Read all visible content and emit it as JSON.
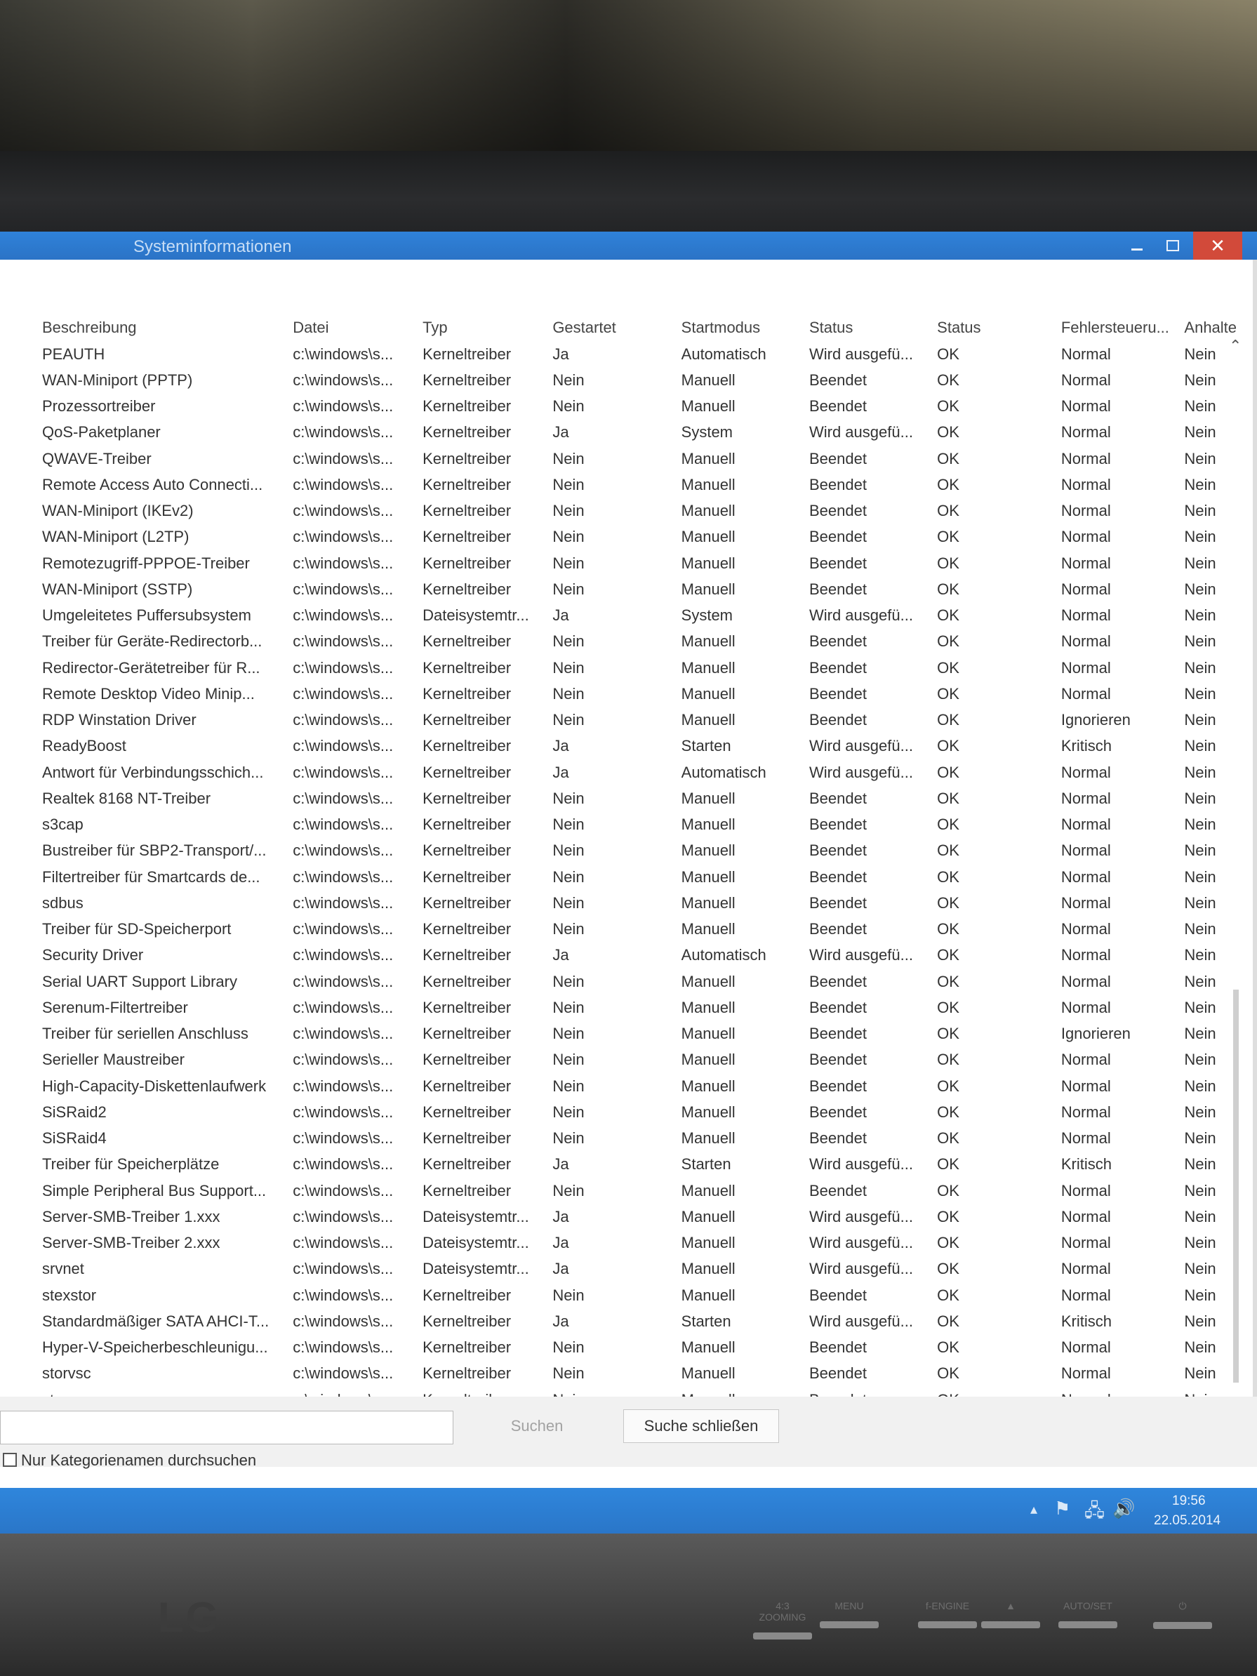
{
  "window": {
    "title": "Systeminformationen",
    "close_glyph": "✕"
  },
  "columns": [
    "Beschreibung",
    "Datei",
    "Typ",
    "Gestartet",
    "Startmodus",
    "Status",
    "Status",
    "Fehlersteueru...",
    "Anhalte"
  ],
  "rows": [
    [
      "PEAUTH",
      "c:\\windows\\s...",
      "Kerneltreiber",
      "Ja",
      "Automatisch",
      "Wird ausgefü...",
      "OK",
      "Normal",
      "Nein"
    ],
    [
      "WAN-Miniport (PPTP)",
      "c:\\windows\\s...",
      "Kerneltreiber",
      "Nein",
      "Manuell",
      "Beendet",
      "OK",
      "Normal",
      "Nein"
    ],
    [
      "Prozessortreiber",
      "c:\\windows\\s...",
      "Kerneltreiber",
      "Nein",
      "Manuell",
      "Beendet",
      "OK",
      "Normal",
      "Nein"
    ],
    [
      "QoS-Paketplaner",
      "c:\\windows\\s...",
      "Kerneltreiber",
      "Ja",
      "System",
      "Wird ausgefü...",
      "OK",
      "Normal",
      "Nein"
    ],
    [
      "QWAVE-Treiber",
      "c:\\windows\\s...",
      "Kerneltreiber",
      "Nein",
      "Manuell",
      "Beendet",
      "OK",
      "Normal",
      "Nein"
    ],
    [
      "Remote Access Auto Connecti...",
      "c:\\windows\\s...",
      "Kerneltreiber",
      "Nein",
      "Manuell",
      "Beendet",
      "OK",
      "Normal",
      "Nein"
    ],
    [
      "WAN-Miniport (IKEv2)",
      "c:\\windows\\s...",
      "Kerneltreiber",
      "Nein",
      "Manuell",
      "Beendet",
      "OK",
      "Normal",
      "Nein"
    ],
    [
      "WAN-Miniport (L2TP)",
      "c:\\windows\\s...",
      "Kerneltreiber",
      "Nein",
      "Manuell",
      "Beendet",
      "OK",
      "Normal",
      "Nein"
    ],
    [
      "Remotezugriff-PPPOE-Treiber",
      "c:\\windows\\s...",
      "Kerneltreiber",
      "Nein",
      "Manuell",
      "Beendet",
      "OK",
      "Normal",
      "Nein"
    ],
    [
      "WAN-Miniport (SSTP)",
      "c:\\windows\\s...",
      "Kerneltreiber",
      "Nein",
      "Manuell",
      "Beendet",
      "OK",
      "Normal",
      "Nein"
    ],
    [
      "Umgeleitetes Puffersubsystem",
      "c:\\windows\\s...",
      "Dateisystemtr...",
      "Ja",
      "System",
      "Wird ausgefü...",
      "OK",
      "Normal",
      "Nein"
    ],
    [
      "Treiber für Geräte-Redirectorb...",
      "c:\\windows\\s...",
      "Kerneltreiber",
      "Nein",
      "Manuell",
      "Beendet",
      "OK",
      "Normal",
      "Nein"
    ],
    [
      "Redirector-Gerätetreiber für R...",
      "c:\\windows\\s...",
      "Kerneltreiber",
      "Nein",
      "Manuell",
      "Beendet",
      "OK",
      "Normal",
      "Nein"
    ],
    [
      "Remote Desktop Video Minip...",
      "c:\\windows\\s...",
      "Kerneltreiber",
      "Nein",
      "Manuell",
      "Beendet",
      "OK",
      "Normal",
      "Nein"
    ],
    [
      "RDP Winstation Driver",
      "c:\\windows\\s...",
      "Kerneltreiber",
      "Nein",
      "Manuell",
      "Beendet",
      "OK",
      "Ignorieren",
      "Nein"
    ],
    [
      "ReadyBoost",
      "c:\\windows\\s...",
      "Kerneltreiber",
      "Ja",
      "Starten",
      "Wird ausgefü...",
      "OK",
      "Kritisch",
      "Nein"
    ],
    [
      "Antwort für Verbindungsschich...",
      "c:\\windows\\s...",
      "Kerneltreiber",
      "Ja",
      "Automatisch",
      "Wird ausgefü...",
      "OK",
      "Normal",
      "Nein"
    ],
    [
      "Realtek 8168 NT-Treiber",
      "c:\\windows\\s...",
      "Kerneltreiber",
      "Nein",
      "Manuell",
      "Beendet",
      "OK",
      "Normal",
      "Nein"
    ],
    [
      "s3cap",
      "c:\\windows\\s...",
      "Kerneltreiber",
      "Nein",
      "Manuell",
      "Beendet",
      "OK",
      "Normal",
      "Nein"
    ],
    [
      "Bustreiber für SBP2-Transport/...",
      "c:\\windows\\s...",
      "Kerneltreiber",
      "Nein",
      "Manuell",
      "Beendet",
      "OK",
      "Normal",
      "Nein"
    ],
    [
      "Filtertreiber für Smartcards de...",
      "c:\\windows\\s...",
      "Kerneltreiber",
      "Nein",
      "Manuell",
      "Beendet",
      "OK",
      "Normal",
      "Nein"
    ],
    [
      "sdbus",
      "c:\\windows\\s...",
      "Kerneltreiber",
      "Nein",
      "Manuell",
      "Beendet",
      "OK",
      "Normal",
      "Nein"
    ],
    [
      "Treiber für SD-Speicherport",
      "c:\\windows\\s...",
      "Kerneltreiber",
      "Nein",
      "Manuell",
      "Beendet",
      "OK",
      "Normal",
      "Nein"
    ],
    [
      "Security Driver",
      "c:\\windows\\s...",
      "Kerneltreiber",
      "Ja",
      "Automatisch",
      "Wird ausgefü...",
      "OK",
      "Normal",
      "Nein"
    ],
    [
      "Serial UART Support Library",
      "c:\\windows\\s...",
      "Kerneltreiber",
      "Nein",
      "Manuell",
      "Beendet",
      "OK",
      "Normal",
      "Nein"
    ],
    [
      "Serenum-Filtertreiber",
      "c:\\windows\\s...",
      "Kerneltreiber",
      "Nein",
      "Manuell",
      "Beendet",
      "OK",
      "Normal",
      "Nein"
    ],
    [
      "Treiber für seriellen Anschluss",
      "c:\\windows\\s...",
      "Kerneltreiber",
      "Nein",
      "Manuell",
      "Beendet",
      "OK",
      "Ignorieren",
      "Nein"
    ],
    [
      "Serieller Maustreiber",
      "c:\\windows\\s...",
      "Kerneltreiber",
      "Nein",
      "Manuell",
      "Beendet",
      "OK",
      "Normal",
      "Nein"
    ],
    [
      "High-Capacity-Diskettenlaufwerk",
      "c:\\windows\\s...",
      "Kerneltreiber",
      "Nein",
      "Manuell",
      "Beendet",
      "OK",
      "Normal",
      "Nein"
    ],
    [
      "SiSRaid2",
      "c:\\windows\\s...",
      "Kerneltreiber",
      "Nein",
      "Manuell",
      "Beendet",
      "OK",
      "Normal",
      "Nein"
    ],
    [
      "SiSRaid4",
      "c:\\windows\\s...",
      "Kerneltreiber",
      "Nein",
      "Manuell",
      "Beendet",
      "OK",
      "Normal",
      "Nein"
    ],
    [
      "Treiber für Speicherplätze",
      "c:\\windows\\s...",
      "Kerneltreiber",
      "Ja",
      "Starten",
      "Wird ausgefü...",
      "OK",
      "Kritisch",
      "Nein"
    ],
    [
      "Simple Peripheral Bus Support...",
      "c:\\windows\\s...",
      "Kerneltreiber",
      "Nein",
      "Manuell",
      "Beendet",
      "OK",
      "Normal",
      "Nein"
    ],
    [
      "Server-SMB-Treiber 1.xxx",
      "c:\\windows\\s...",
      "Dateisystemtr...",
      "Ja",
      "Manuell",
      "Wird ausgefü...",
      "OK",
      "Normal",
      "Nein"
    ],
    [
      "Server-SMB-Treiber 2.xxx",
      "c:\\windows\\s...",
      "Dateisystemtr...",
      "Ja",
      "Manuell",
      "Wird ausgefü...",
      "OK",
      "Normal",
      "Nein"
    ],
    [
      "srvnet",
      "c:\\windows\\s...",
      "Dateisystemtr...",
      "Ja",
      "Manuell",
      "Wird ausgefü...",
      "OK",
      "Normal",
      "Nein"
    ],
    [
      "stexstor",
      "c:\\windows\\s...",
      "Kerneltreiber",
      "Nein",
      "Manuell",
      "Beendet",
      "OK",
      "Normal",
      "Nein"
    ],
    [
      "Standardmäßiger SATA AHCI-T...",
      "c:\\windows\\s...",
      "Kerneltreiber",
      "Ja",
      "Starten",
      "Wird ausgefü...",
      "OK",
      "Kritisch",
      "Nein"
    ],
    [
      "Hyper-V-Speicherbeschleunigu...",
      "c:\\windows\\s...",
      "Kerneltreiber",
      "Nein",
      "Manuell",
      "Beendet",
      "OK",
      "Normal",
      "Nein"
    ],
    [
      "storvsc",
      "c:\\windows\\s...",
      "Kerneltreiber",
      "Nein",
      "Manuell",
      "Beendet",
      "OK",
      "Normal",
      "Nein"
    ],
    [
      "storvsp",
      "c:\\windows\\s...",
      "Kerneltreiber",
      "Nein",
      "Manuell",
      "Beendet",
      "OK",
      "Normal",
      "Nein"
    ]
  ],
  "search": {
    "input_value": "",
    "search_label": "Suchen",
    "close_label": "Suche schließen",
    "checkbox_label": "Nur Kategorienamen durchsuchen",
    "checkbox_checked": false
  },
  "taskbar": {
    "time": "19:56",
    "date": "22.05.2014",
    "icons": [
      "chevron-up-icon",
      "action-center-flag-icon",
      "network-icon",
      "volume-icon"
    ]
  },
  "monitor": {
    "brand": "LG",
    "buttons": [
      "4:3 ZOOMING",
      "MENU",
      "f-ENGINE",
      "▲",
      "AUTO/SET",
      "⏻"
    ]
  },
  "colors": {
    "titlebar": "#2b73c6",
    "taskbar": "#2a76c8",
    "close_button": "#d24a3a"
  }
}
